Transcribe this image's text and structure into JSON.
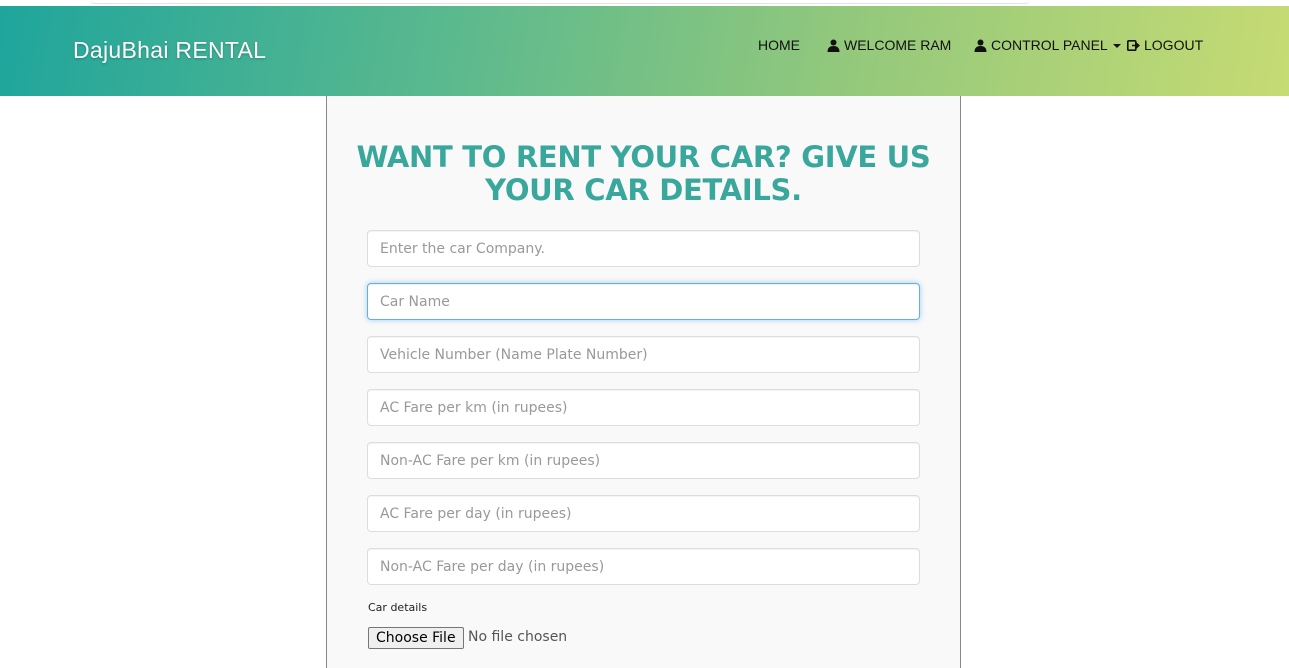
{
  "navbar": {
    "brand": "DajuBhai RENTAL",
    "items": [
      {
        "label": "HOME",
        "icon": ""
      },
      {
        "label": "WELCOME RAM",
        "icon": "user-icon"
      },
      {
        "label": "CONTROL PANEL",
        "icon": "user-icon",
        "dropdown": true
      },
      {
        "label": "LOGOUT",
        "icon": "logout-icon"
      }
    ]
  },
  "form": {
    "heading": "WANT TO RENT YOUR CAR? GIVE US YOUR CAR DETAILS.",
    "fields": [
      {
        "placeholder": "Enter the car Company.",
        "value": ""
      },
      {
        "placeholder": "Car Name",
        "value": ""
      },
      {
        "placeholder": "Vehicle Number (Name Plate Number)",
        "value": ""
      },
      {
        "placeholder": "AC Fare per km (in rupees)",
        "value": ""
      },
      {
        "placeholder": "Non-AC Fare per km (in rupees)",
        "value": ""
      },
      {
        "placeholder": "AC Fare per day (in rupees)",
        "value": ""
      },
      {
        "placeholder": "Non-AC Fare per day (in rupees)",
        "value": ""
      }
    ],
    "file_label": "Car details",
    "file_button": "Choose File",
    "file_status": "No file chosen"
  },
  "colors": {
    "heading": "#3aa79c",
    "nav_gradient_start": "#1fa59c",
    "nav_gradient_end": "#c6db73",
    "focus_border": "#66afe9"
  }
}
